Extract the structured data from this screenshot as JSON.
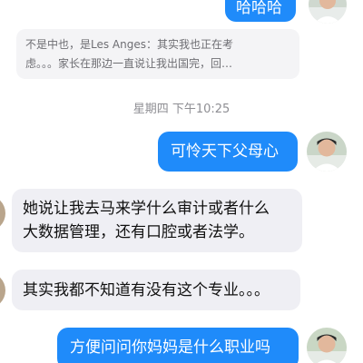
{
  "conversation": {
    "messages": [
      {
        "direction": "out",
        "text": "哈哈哈"
      },
      {
        "direction": "reply_quote",
        "lines": [
          "不是中也，是Les Anges：其实我也正在考",
          "虑。。。家长在那边一直说让我出国完，回…"
        ]
      },
      {
        "direction": "timestamp",
        "text": "星期四 下午10:25"
      },
      {
        "direction": "out",
        "text": "可怜天下父母心"
      },
      {
        "direction": "in",
        "lines": [
          "她说让我去马来学什么审计或者什么",
          "大数据管理，还有口腔或者法学。"
        ]
      },
      {
        "direction": "in",
        "text": "其实我都不知道有没有这个专业。。。"
      },
      {
        "direction": "out",
        "text": "方便问问你妈妈是什么职业吗"
      }
    ]
  },
  "colors": {
    "outgoing_bubble": "#1f8bfa",
    "incoming_bubble": "#efeff4",
    "quote_box": "#f4f4f6",
    "timestamp_text": "#8e8e93"
  },
  "icons": {
    "avatar": "user-avatar-icon"
  }
}
